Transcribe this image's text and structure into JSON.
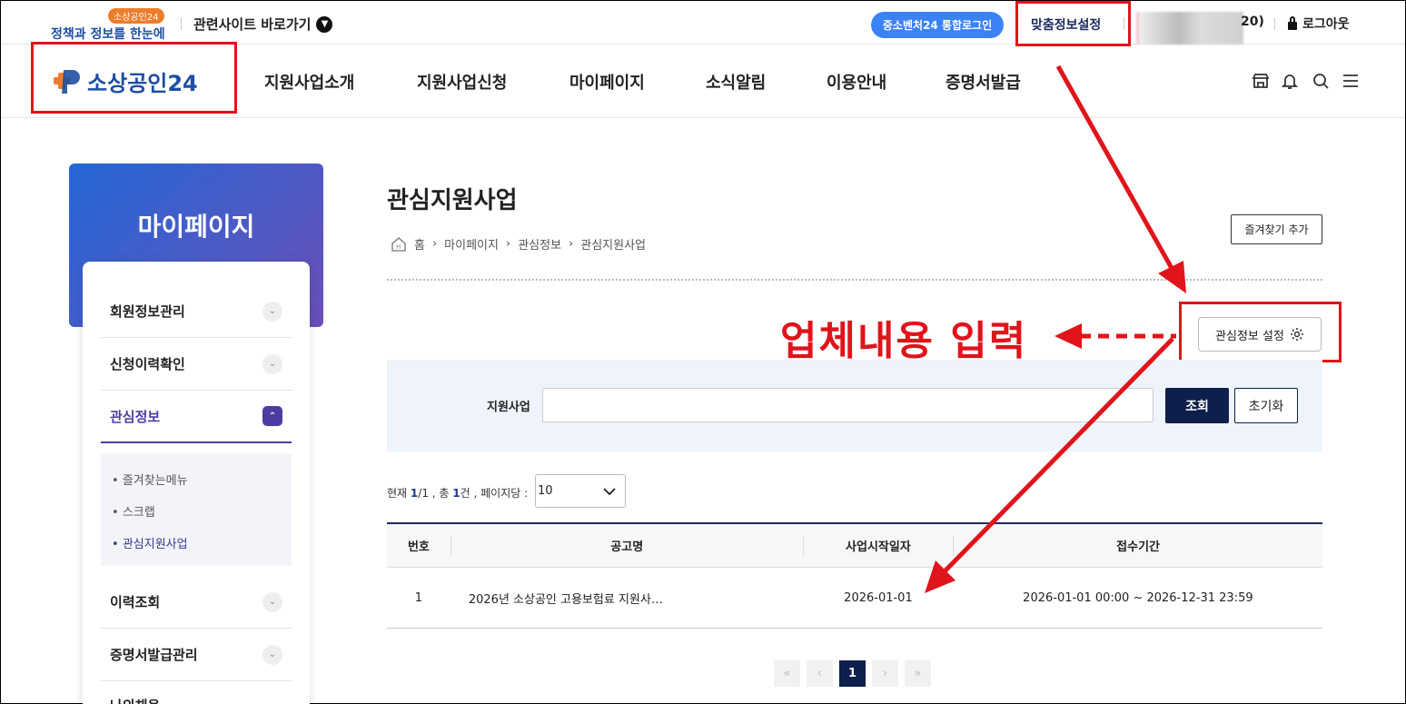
{
  "topbar": {
    "badge": "소상공인24",
    "tagline": "정책과 정보를 한눈에",
    "related_sites": "관련사이트 바로가기",
    "sso_login": "중소벤처24 통합로그인",
    "custom_settings": "맞춤정보설정",
    "user_suffix": "20)",
    "logout": "로그아웃"
  },
  "header": {
    "logo_text": "소상공인24",
    "nav": [
      "지원사업소개",
      "지원사업신청",
      "마이페이지",
      "소식알림",
      "이용안내",
      "증명서발급"
    ],
    "icons": [
      "store-icon",
      "bell-icon",
      "search-icon",
      "menu-icon"
    ]
  },
  "sidebar": {
    "title": "마이페이지",
    "items": [
      {
        "label": "회원정보관리",
        "expanded": false
      },
      {
        "label": "신청이력확인",
        "expanded": false
      },
      {
        "label": "관심정보",
        "expanded": true
      },
      {
        "label": "이력조회",
        "expanded": false
      },
      {
        "label": "증명서발급관리",
        "expanded": false
      },
      {
        "label": "나의채용",
        "expanded": false
      }
    ],
    "sub_items": [
      "즐겨찾는메뉴",
      "스크랩",
      "관심지원사업"
    ],
    "current_sub": "관심지원사업"
  },
  "content": {
    "title": "관심지원사업",
    "breadcrumb": [
      "홈",
      "마이페이지",
      "관심정보",
      "관심지원사업"
    ],
    "favorite_button": "즐겨찾기 추가",
    "interest_button": "관심정보 설정",
    "annotation": "업체내용 입력",
    "search": {
      "label": "지원사업",
      "value": "",
      "search_button": "조회",
      "reset_button": "초기화"
    },
    "count": {
      "prefix": "현재",
      "current": "1",
      "total_pages": "/1",
      "mid": ", 총",
      "total": "1",
      "suffix": "건 , 페이지당 :"
    },
    "per_page": "10",
    "table": {
      "headers": [
        "번호",
        "공고명",
        "사업시작일자",
        "접수기간"
      ],
      "rows": [
        {
          "no": "1",
          "title": "2026년 소상공인 고용보험료 지원사…",
          "start": "2026-01-01",
          "period": "2026-01-01 00:00 ~ 2026-12-31 23:59"
        }
      ]
    },
    "pagination": {
      "first": "«",
      "prev": "‹",
      "current": "1",
      "next": "›",
      "last": "»"
    }
  },
  "colors": {
    "brand": "#1e4fa3",
    "annotation_red": "#e0141b",
    "navy": "#0f1f4b",
    "accent_orange": "#ee7d2b"
  }
}
